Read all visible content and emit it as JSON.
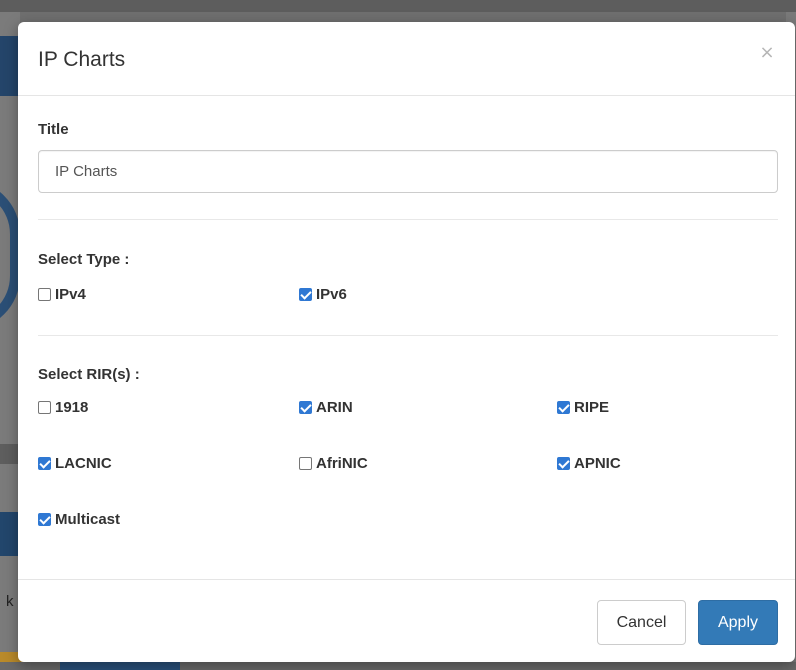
{
  "modal": {
    "title": "IP Charts",
    "close_symbol": "×"
  },
  "title_field": {
    "label": "Title",
    "value": "IP Charts"
  },
  "type_section": {
    "label": "Select Type :",
    "options": [
      {
        "label": "IPv4",
        "checked": false
      },
      {
        "label": "IPv6",
        "checked": true
      }
    ]
  },
  "rir_section": {
    "label": "Select RIR(s) :",
    "options": [
      {
        "label": "1918",
        "checked": false
      },
      {
        "label": "ARIN",
        "checked": true
      },
      {
        "label": "RIPE",
        "checked": true
      },
      {
        "label": "LACNIC",
        "checked": true
      },
      {
        "label": "AfriNIC",
        "checked": false
      },
      {
        "label": "APNIC",
        "checked": true
      },
      {
        "label": "Multicast",
        "checked": true
      }
    ]
  },
  "footer": {
    "cancel_label": "Cancel",
    "apply_label": "Apply"
  },
  "background": {
    "partial_letter": "k"
  },
  "colors": {
    "checkbox_checked": "#2f78d3",
    "primary_button": "#337ab7"
  },
  "icons": {
    "close": "close-icon",
    "checked": "checkbox-checked-icon",
    "unchecked": "checkbox-unchecked-icon"
  }
}
